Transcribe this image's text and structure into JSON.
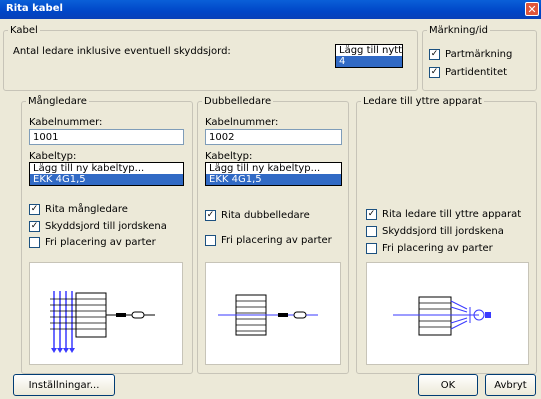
{
  "window": {
    "title": "Rita kabel",
    "close": "✕"
  },
  "kabel": {
    "legend": "Kabel",
    "label": "Antal ledare inklusive eventuell skyddsjord:",
    "options": [
      "Lägg till nytt ai",
      "4"
    ],
    "selected_index": 1
  },
  "markning": {
    "legend": "Märkning/id",
    "items": [
      {
        "label": "Partmärkning",
        "checked": true
      },
      {
        "label": "Partidentitet",
        "checked": true
      }
    ]
  },
  "mangledare": {
    "legend": "Mångledare",
    "cable_number_label": "Kabelnummer:",
    "cable_number": "1001",
    "cable_type_label": "Kabeltyp:",
    "types": [
      "Lägg till ny kabeltyp...",
      "EKK 4G1,5"
    ],
    "selected_index": 1,
    "options": [
      {
        "label": "Rita mångledare",
        "checked": true
      },
      {
        "label": "Skyddsjord till jordskena",
        "checked": true
      },
      {
        "label": "Fri placering av parter",
        "checked": false
      }
    ]
  },
  "dubbelledare": {
    "legend": "Dubbelledare",
    "cable_number_label": "Kabelnummer:",
    "cable_number": "1002",
    "cable_type_label": "Kabeltyp:",
    "types": [
      "Lägg till ny kabeltyp...",
      "EKK 4G1,5"
    ],
    "selected_index": 1,
    "options": [
      {
        "label": "Rita dubbelledare",
        "checked": true
      },
      {
        "label": "Fri placering av parter",
        "checked": false
      }
    ]
  },
  "yttre": {
    "legend": "Ledare till yttre apparat",
    "options": [
      {
        "label": "Rita ledare till yttre apparat",
        "checked": true
      },
      {
        "label": "Skyddsjord till jordskena",
        "checked": false
      },
      {
        "label": "Fri placering av parter",
        "checked": false
      }
    ]
  },
  "buttons": {
    "settings": "Inställningar...",
    "ok": "OK",
    "cancel": "Avbryt"
  }
}
